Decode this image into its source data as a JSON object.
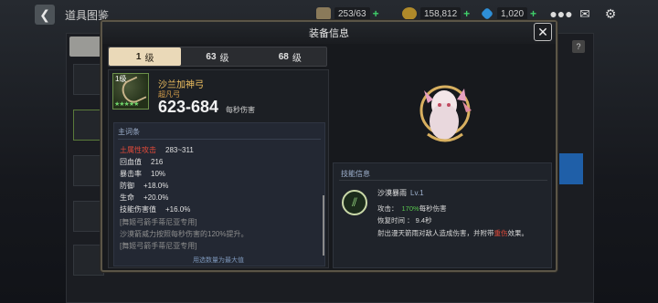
{
  "topbar": {
    "page_title": "道具图鉴",
    "stamina": "253/63",
    "gold": "158,812",
    "gems": "1,020",
    "colors": {
      "accent_plus": "#3fd06a"
    }
  },
  "modal": {
    "title": "装备信息",
    "tabs": [
      {
        "num": "1",
        "label": "级"
      },
      {
        "num": "63",
        "label": "级"
      },
      {
        "num": "68",
        "label": "级"
      }
    ],
    "item": {
      "level_badge": "1级",
      "stars": "★★★★★",
      "name": "沙兰加神弓",
      "rarity": "超凡弓",
      "damage": "623-684",
      "damage_label": "每秒伤害"
    },
    "stats": {
      "title": "主词条",
      "lines": [
        {
          "key": "土属性攻击",
          "value": "283~311",
          "highlight": true
        },
        {
          "key": "回血值",
          "value": "216"
        },
        {
          "key": "暴击率",
          "value": "10%"
        },
        {
          "key": "防御",
          "value": "+18.0%"
        },
        {
          "key": "生命",
          "value": "+20.0%"
        },
        {
          "key": "技能伤害值",
          "value": "+16.0%"
        }
      ],
      "notes": [
        "[舞姬弓箭手蒂尼亚专用]",
        "沙漠箭威力按照每秒伤害的120%提升。",
        "[舞姬弓箭手蒂尼亚专用]"
      ],
      "footnote": "用选数量为最大值"
    },
    "skill": {
      "title": "技能信息",
      "name": "沙漠暴雨",
      "level": "Lv.1",
      "attack_prefix": "攻击：",
      "attack_value": "170%",
      "attack_suffix": "每秒伤害",
      "cooldown": "恢复时间 ： 9.4秒",
      "desc_prefix": "射出漫天箭雨对敌人造成伤害，并附带",
      "desc_highlight": "重伤",
      "desc_suffix": "效果。"
    }
  }
}
